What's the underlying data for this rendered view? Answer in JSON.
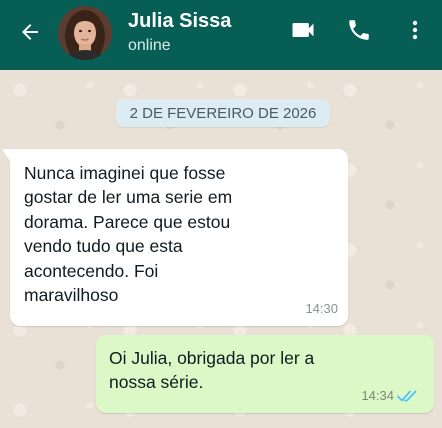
{
  "header": {
    "contact_name": "Julia Sissa",
    "status": "online",
    "back_icon": "arrow-left-icon",
    "video_icon": "videocam-icon",
    "call_icon": "phone-icon",
    "menu_icon": "more-vert-icon",
    "background_color": "#075e54"
  },
  "chat": {
    "date_separator": "2 DE FEVEREIRO DE 2026",
    "messages": [
      {
        "direction": "incoming",
        "lines": [
          "Nunca imaginei que fosse",
          "gostar de ler uma serie em",
          "dorama. Parece que estou",
          "vendo tudo que esta",
          "acontecendo. Foi",
          "maravilhoso"
        ],
        "time": "14:30"
      },
      {
        "direction": "outgoing",
        "lines": [
          "Oi Julia, obrigada por ler a",
          "nossa série."
        ],
        "time": "14:34",
        "status_icon": "double-check-read-icon",
        "status_color": "#4fc3f7"
      }
    ],
    "outgoing_bubble_color": "#dcf8c6",
    "incoming_bubble_color": "#ffffff"
  }
}
